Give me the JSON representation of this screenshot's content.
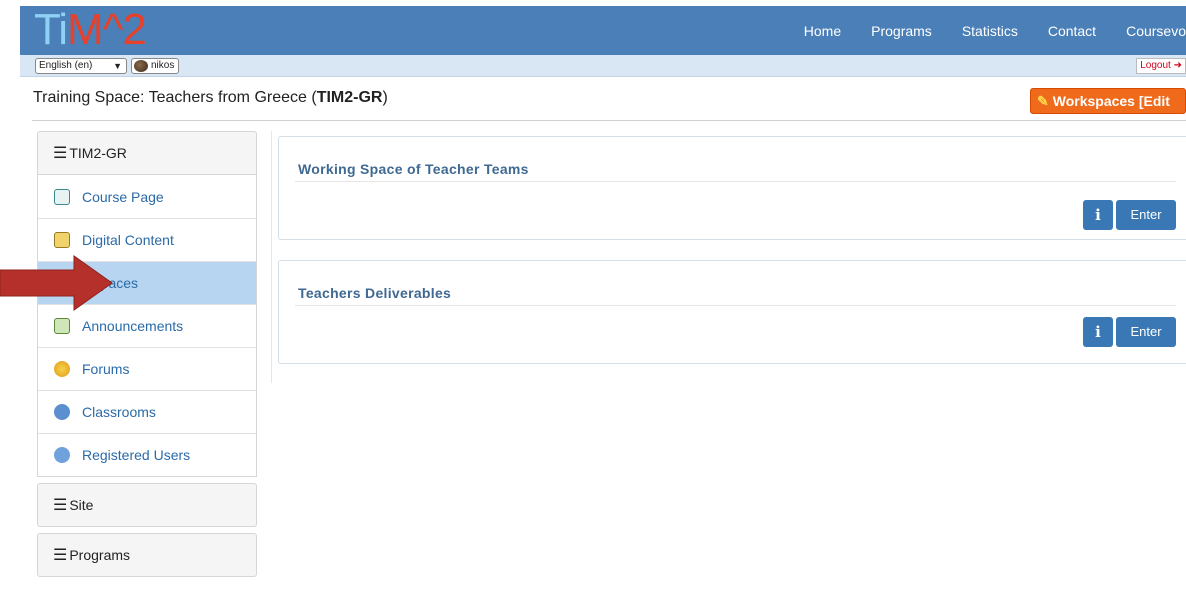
{
  "header": {
    "logo_part1": "Ti",
    "logo_part2": "M^2",
    "nav": [
      "Home",
      "Programs",
      "Statistics",
      "Contact",
      "Coursevo"
    ]
  },
  "subbar": {
    "language": "English (en)",
    "username": "nikos",
    "logout_label": "Logout"
  },
  "space": {
    "title_prefix": "Training Space: Teachers from Greece (",
    "code": "TIM2-GR",
    "title_suffix": ")",
    "edit_button": "Workspaces [Edit"
  },
  "sidebar": {
    "course_header": "TIM2-GR",
    "items": [
      {
        "label": "Course Page",
        "icon": "course-page-icon"
      },
      {
        "label": "Digital Content",
        "icon": "digital-content-icon"
      },
      {
        "label": "rkspaces",
        "icon": "workspaces-icon"
      },
      {
        "label": "Announcements",
        "icon": "announcements-icon"
      },
      {
        "label": "Forums",
        "icon": "forums-icon"
      },
      {
        "label": "Classrooms",
        "icon": "classrooms-icon"
      },
      {
        "label": "Registered Users",
        "icon": "registered-users-icon"
      }
    ],
    "active_index": 2,
    "site_label": "Site",
    "programs_label": "Programs"
  },
  "workspaces": [
    {
      "title": "Working Space of Teacher Teams",
      "info": "i",
      "enter": "Enter"
    },
    {
      "title": "Teachers Deliverables",
      "info": "i",
      "enter": "Enter"
    }
  ],
  "colors": {
    "topbar": "#4a7fb8",
    "accent": "#3a78b5",
    "active_item": "#b7d5f0",
    "edit_button": "#ef6a1b",
    "arrow": "#b5302b"
  }
}
